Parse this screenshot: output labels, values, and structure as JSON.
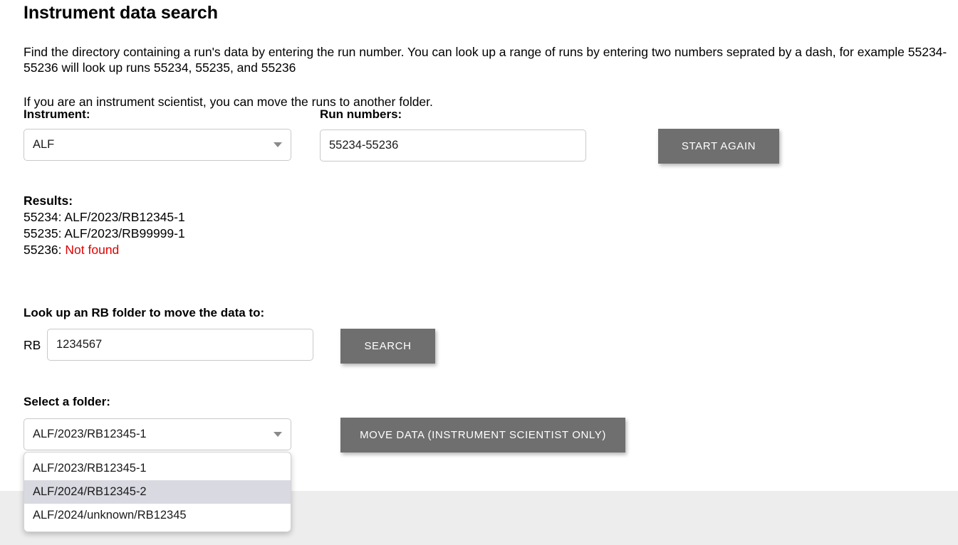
{
  "page": {
    "title": "Instrument data search",
    "intro_paragraph": "Find the directory containing a run's data by entering the run number. You can look up a range of runs by entering two numbers seprated by a dash, for example 55234-55236 will look up runs 55234, 55235, and 55236",
    "scientist_note": "If you are an instrument scientist, you can move the runs to another folder."
  },
  "search_form": {
    "instrument_label": "Instrument:",
    "instrument_value": "ALF",
    "runs_label": "Run numbers:",
    "runs_value": "55234-55236",
    "runs_placeholder": "",
    "start_again_label": "START AGAIN"
  },
  "results": {
    "heading": "Results:",
    "rows": [
      {
        "run": "55234: ",
        "path": "ALF/2023/RB12345-1",
        "found": true
      },
      {
        "run": "55235: ",
        "path": "ALF/2023/RB99999-1",
        "found": true
      },
      {
        "run": "55236: ",
        "path": "Not found",
        "found": false
      }
    ]
  },
  "rb_lookup": {
    "heading": "Look up an RB folder to move the data to:",
    "prefix_label": "RB",
    "value": "1234567",
    "placeholder": "",
    "search_label": "SEARCH"
  },
  "folder_section": {
    "heading": "Select a folder:",
    "selected": "ALF/2023/RB12345-1",
    "options": [
      "ALF/2023/RB12345-1",
      "ALF/2024/RB12345-2",
      "ALF/2024/unknown/RB12345"
    ],
    "highlighted_index": 1,
    "move_data_label": "MOVE DATA (INSTRUMENT SCIENTIST ONLY)"
  },
  "colors": {
    "button_grey": "#6f6f6f",
    "error_red": "#e00000",
    "highlight": "#d9d9e1",
    "footer_band": "#ededed"
  }
}
